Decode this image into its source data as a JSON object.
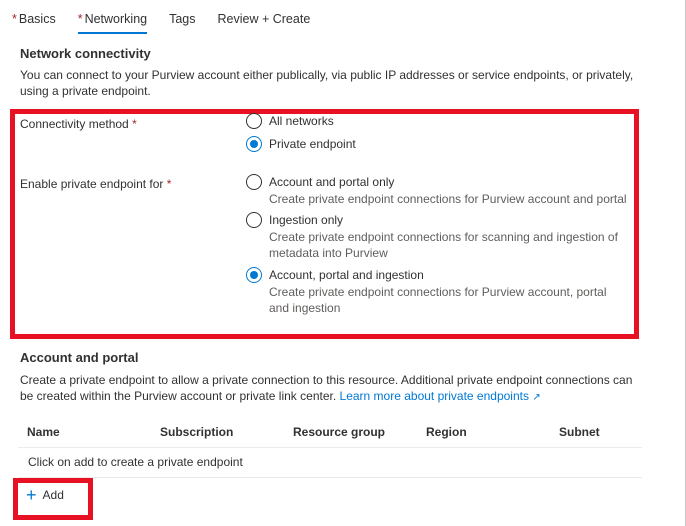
{
  "tabs": [
    {
      "label": "Basics",
      "required": "*"
    },
    {
      "label": "Networking",
      "required": "*"
    },
    {
      "label": "Tags",
      "required": ""
    },
    {
      "label": "Review + Create",
      "required": ""
    }
  ],
  "network": {
    "title": "Network connectivity",
    "description": "You can connect to your Purview account either publically, via public IP addresses or service endpoints, or privately, using a private endpoint.",
    "connectivity_label": "Connectivity method",
    "connectivity_options": [
      {
        "label": "All networks",
        "checked": false
      },
      {
        "label": "Private endpoint",
        "checked": true
      }
    ],
    "enable_label": "Enable private endpoint for",
    "enable_options": [
      {
        "label": "Account and portal only",
        "desc": "Create private endpoint connections for Purview account and portal",
        "checked": false
      },
      {
        "label": "Ingestion only",
        "desc": "Create private endpoint connections for scanning and ingestion of metadata into Purview",
        "checked": false
      },
      {
        "label": "Account, portal and ingestion",
        "desc": "Create private endpoint connections for Purview account, portal and ingestion",
        "checked": true
      }
    ],
    "required_mark": "*"
  },
  "account": {
    "title": "Account and portal",
    "description": "Create a private endpoint to allow a private connection to this resource. Additional private endpoint connections can be created within the Purview account or private link center.",
    "link_text": "Learn more about private endpoints",
    "external_icon": "↗"
  },
  "table": {
    "columns": [
      "Name",
      "Subscription",
      "Resource group",
      "Region",
      "Subnet"
    ],
    "empty_text": "Click on add to create a private endpoint"
  },
  "add": {
    "label": "Add",
    "icon": "+"
  },
  "colors": {
    "accent": "#0078d4",
    "highlight": "#e81123",
    "required": "#a4262c"
  }
}
